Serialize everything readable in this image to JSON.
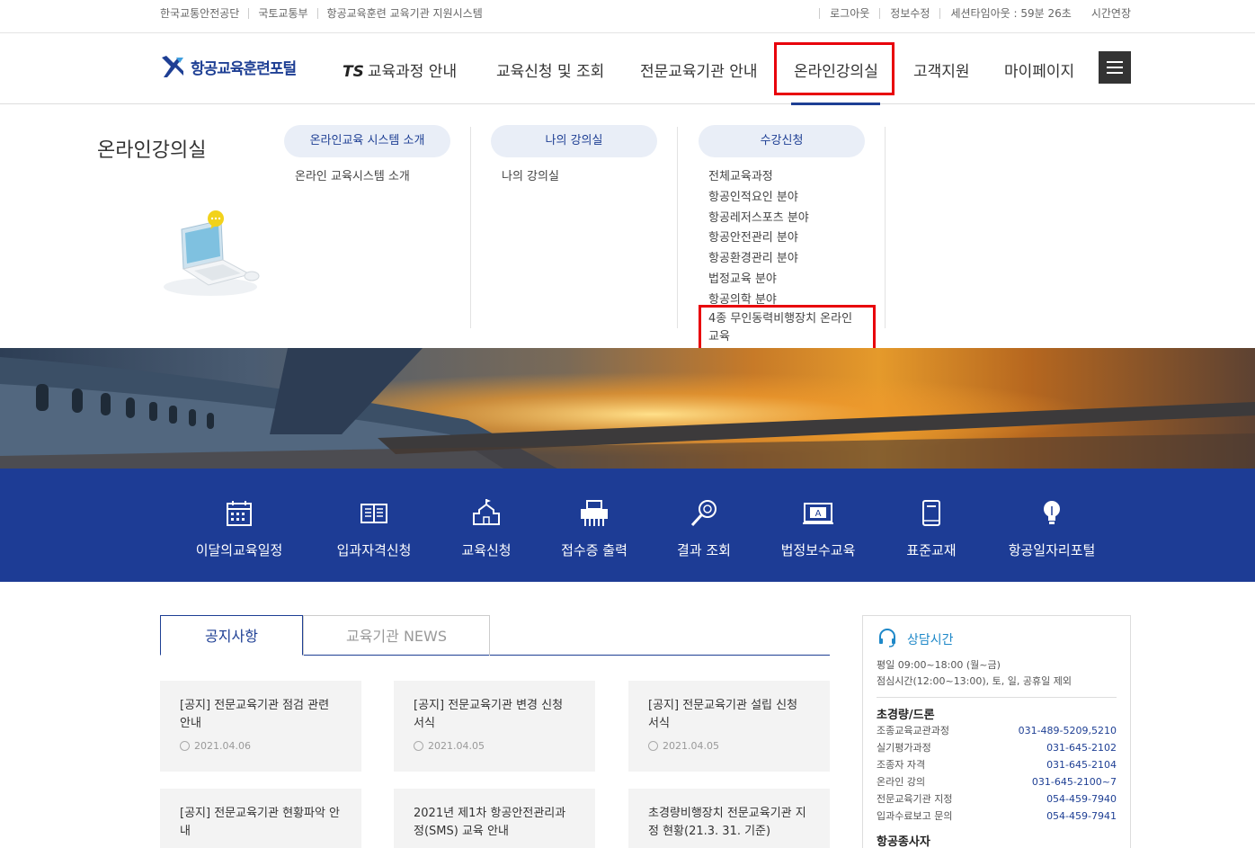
{
  "utility": {
    "left_links": [
      "한국교통안전공단",
      "국토교통부",
      "항공교육훈련 교육기관 지원시스템"
    ],
    "logout": "로그아웃",
    "edit_info": "정보수정",
    "session": "세션타임아웃 : 59분 26초",
    "extend": "시간연장"
  },
  "header": {
    "logo_text": "항공교육훈련포털",
    "nav": {
      "ts": "TS",
      "courses": "교육과정 안내",
      "apply": "교육신청 및 조회",
      "institutions": "전문교육기관 안내",
      "online": "온라인강의실",
      "support": "고객지원",
      "mypage": "마이페이지"
    }
  },
  "mega": {
    "title": "온라인강의실",
    "col1": {
      "pill": "온라인교육 시스템 소개",
      "links": [
        "온라인 교육시스템 소개"
      ]
    },
    "col2": {
      "pill": "나의 강의실",
      "links": [
        "나의 강의실"
      ]
    },
    "col3": {
      "pill": "수강신청",
      "links": [
        "전체교육과정",
        "항공인적요인 분야",
        "항공레저스포츠 분야",
        "항공안전관리 분야",
        "항공환경관리 분야",
        "법정교육 분야",
        "항공의학 분야"
      ],
      "highlight_line1": "4종 무인동력비행장치 온라인",
      "highlight_line2": "교육"
    }
  },
  "quick": [
    {
      "label": "이달의교육일정",
      "icon": "calendar-icon"
    },
    {
      "label": "입과자격신청",
      "icon": "book-icon"
    },
    {
      "label": "교육신청",
      "icon": "school-icon"
    },
    {
      "label": "접수증 출력",
      "icon": "printer-icon"
    },
    {
      "label": "결과 조회",
      "icon": "magnifier-icon"
    },
    {
      "label": "법정보수교육",
      "icon": "monitor-icon"
    },
    {
      "label": "표준교재",
      "icon": "textbook-icon"
    },
    {
      "label": "항공일자리포털",
      "icon": "lightbulb-icon"
    }
  ],
  "tabs": {
    "notice": "공지사항",
    "news": "교육기관 NEWS"
  },
  "notices": [
    {
      "title": "[공지] 전문교육기관 점검 관련 안내",
      "date": "2021.04.06"
    },
    {
      "title": "[공지] 전문교육기관 변경 신청 서식",
      "date": "2021.04.05"
    },
    {
      "title": "[공지] 전문교육기관 설립 신청 서식",
      "date": "2021.04.05"
    },
    {
      "title": "[공지] 전문교육기관 현황파악 안내",
      "date": ""
    },
    {
      "title": "2021년 제1차 항공안전관리과정(SMS) 교육 안내",
      "date": ""
    },
    {
      "title": "초경량비행장치 전문교육기관 지정 현황(21.3. 31. 기준)",
      "date": ""
    }
  ],
  "consult": {
    "title": "상담시간",
    "hours1": "평일 09:00~18:00 (월~금)",
    "hours2": "점심시간(12:00~13:00), 토, 일, 공휴일 제외",
    "section1": "초경량/드론",
    "rows": [
      {
        "label": "조종교육교관과정",
        "phone": "031-489-5209,5210"
      },
      {
        "label": "실기평가과정",
        "phone": "031-645-2102"
      },
      {
        "label": "조종자 자격",
        "phone": "031-645-2104"
      },
      {
        "label": "온라인 강의",
        "phone": "031-645-2100~7"
      },
      {
        "label": "전문교육기관 지정",
        "phone": "054-459-7940"
      },
      {
        "label": "입과수료보고 문의",
        "phone": "054-459-7941"
      }
    ],
    "section2": "항공종사자"
  },
  "colors": {
    "brand_blue": "#1e3f94",
    "highlight_red": "#e8000b",
    "quick_bar": "#1d3c95"
  }
}
